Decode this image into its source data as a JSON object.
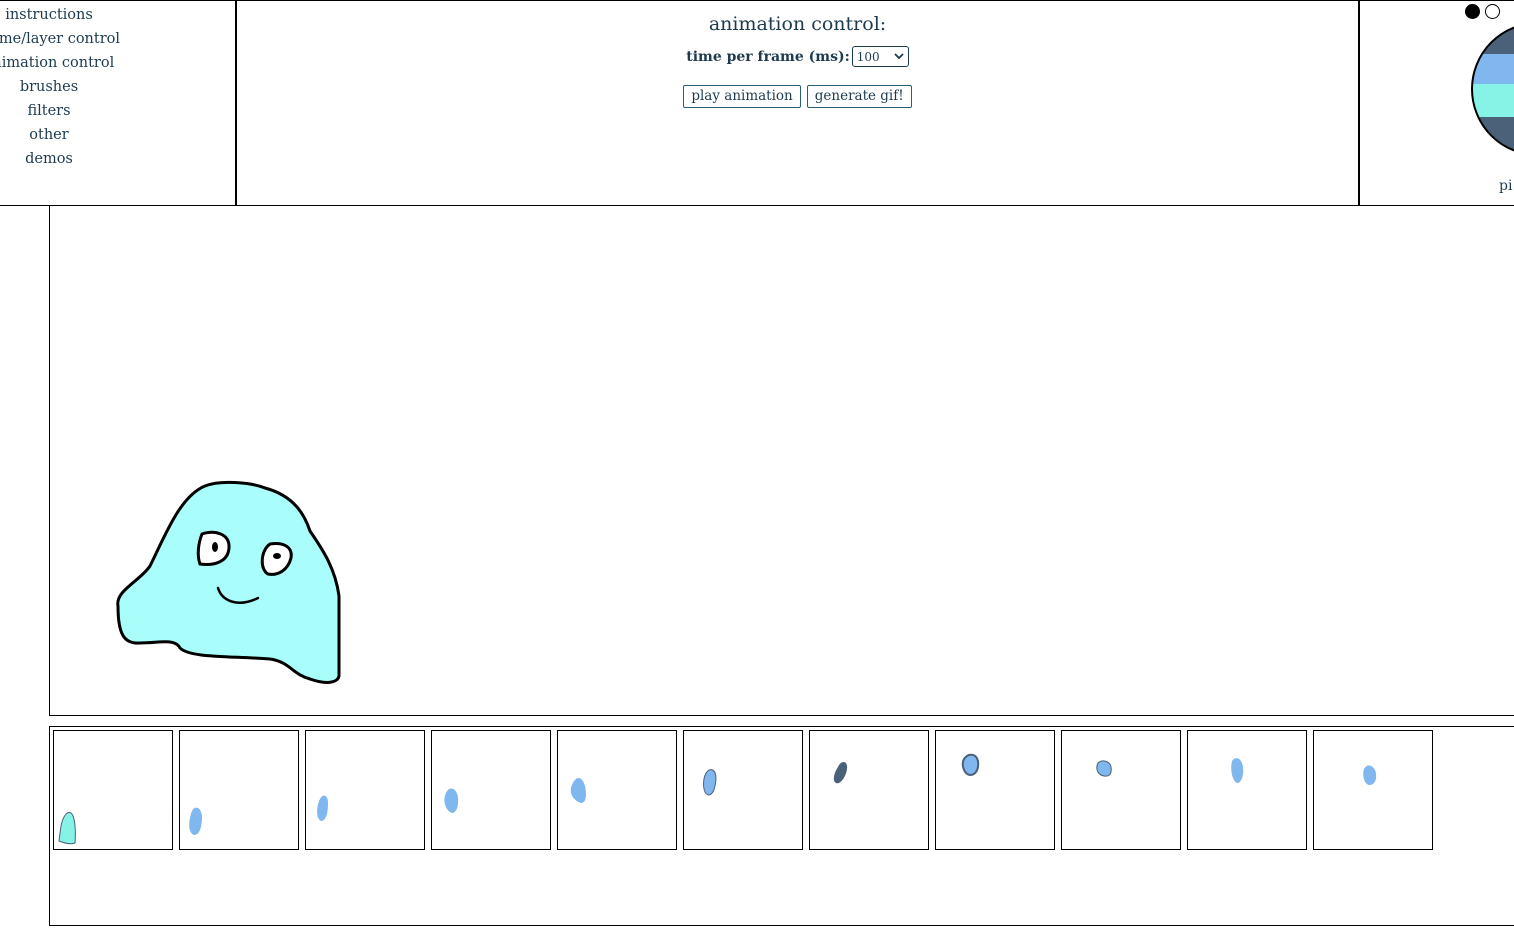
{
  "menu": {
    "items": [
      {
        "label": "instructions"
      },
      {
        "label": "frame/layer control"
      },
      {
        "label": "animation control"
      },
      {
        "label": "brushes"
      },
      {
        "label": "filters"
      },
      {
        "label": "other"
      },
      {
        "label": "demos"
      }
    ]
  },
  "animation_panel": {
    "title": "animation control:",
    "time_per_frame_label": "time per frame (ms):",
    "time_per_frame_value": "100",
    "play_button": "play animation",
    "gif_button": "generate gif!"
  },
  "color_panel": {
    "picker_label": "pi",
    "swatches": [
      "#000000",
      "#ffffff"
    ],
    "wheel_colors": [
      "#4a6179",
      "#7fb7ee",
      "#86f3e6",
      "#4a6179"
    ]
  },
  "canvas": {
    "blob_fill": "#a9fdfa",
    "outline": "#000000"
  },
  "frames": {
    "count": 11,
    "blob_colors": [
      "#86f3e6",
      "#7fb7ee",
      "#7fb7ee",
      "#7fb7ee",
      "#7fb7ee",
      "#7fb7ee",
      "#4a6179",
      "#4a6179",
      "#7fb7ee",
      "#7fb7ee",
      "#7fb7ee"
    ]
  }
}
